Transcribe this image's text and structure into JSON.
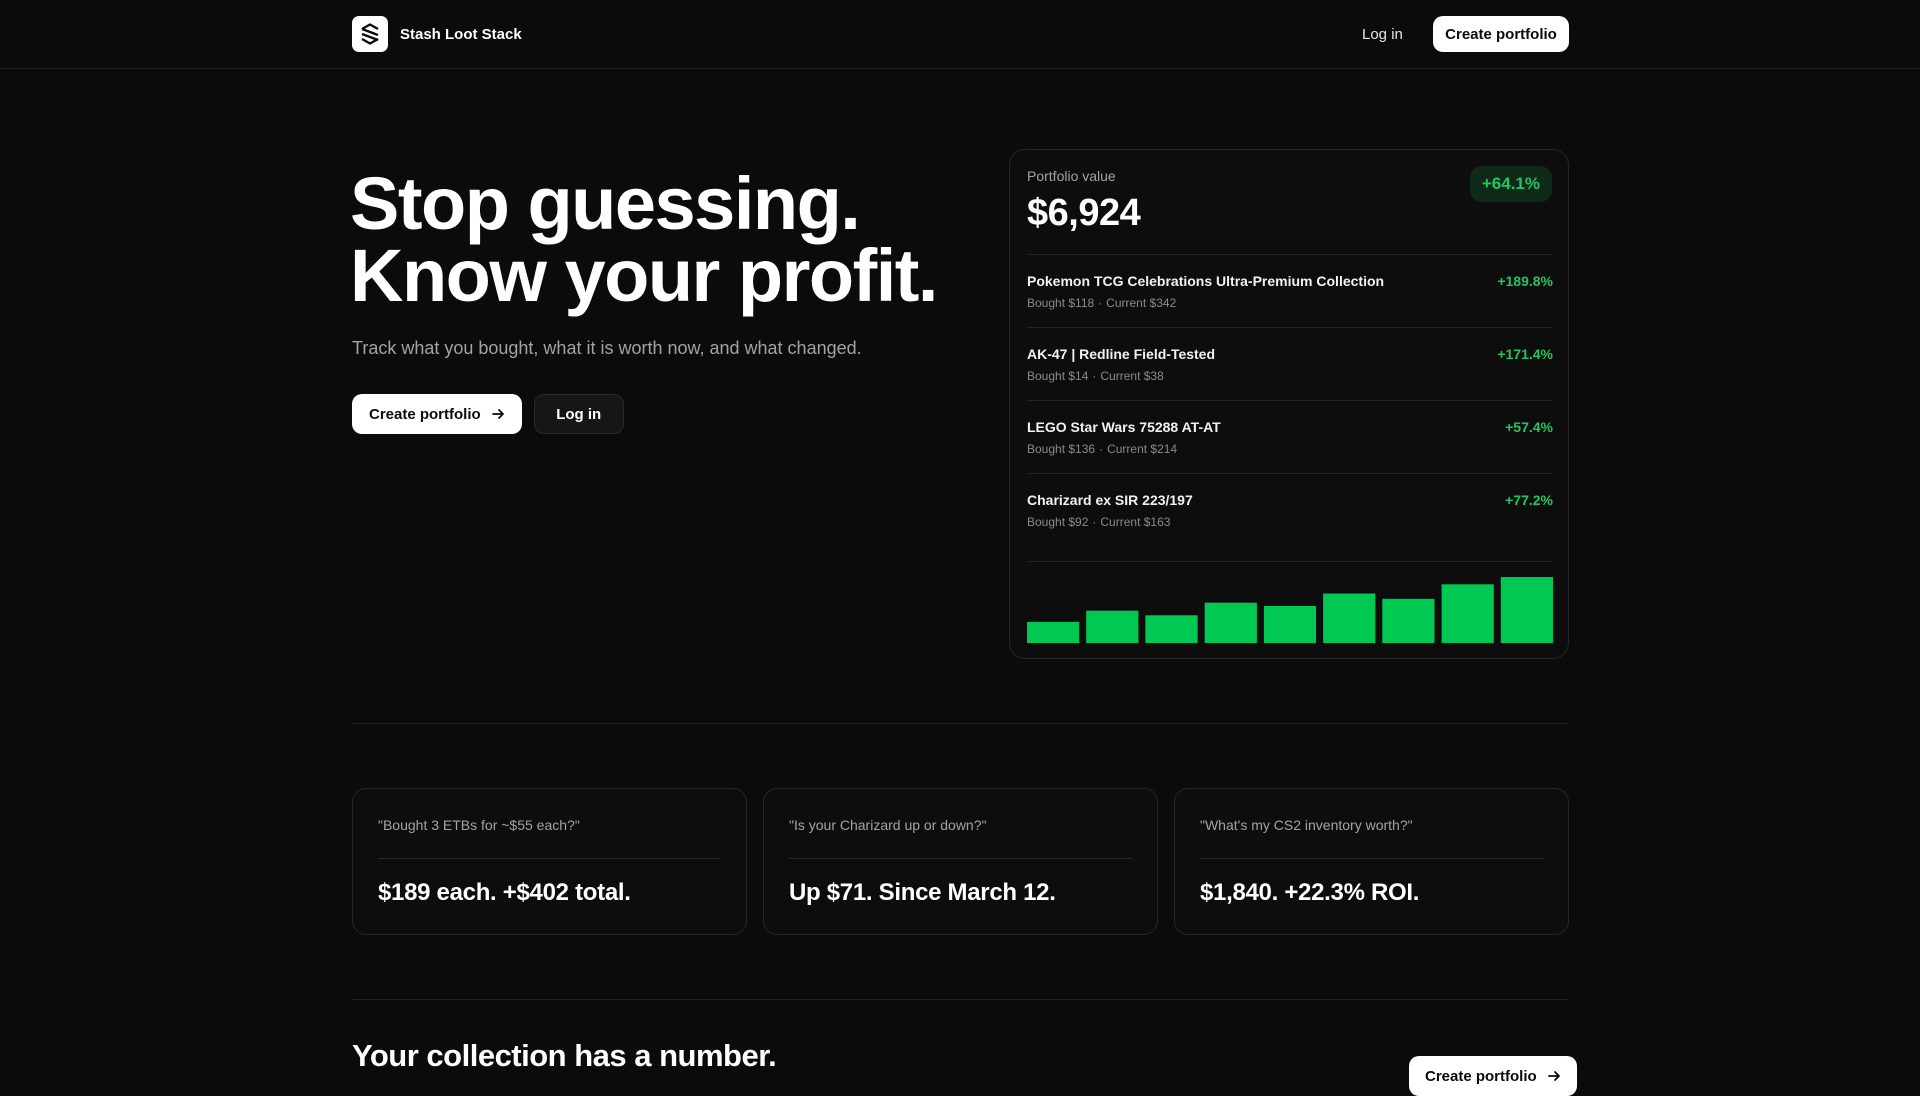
{
  "header": {
    "brand_name": "Stash Loot Stack",
    "login_label": "Log in",
    "create_label": "Create portfolio"
  },
  "hero": {
    "title_line1": "Stop guessing.",
    "title_line2": "Know your profit.",
    "subtitle": "Track what you bought, what it is worth now, and what changed.",
    "primary_cta": "Create portfolio",
    "secondary_cta": "Log in"
  },
  "portfolio": {
    "label": "Portfolio value",
    "value": "$6,924",
    "change": "+64.1%",
    "items": [
      {
        "name": "Pokemon TCG Celebrations Ultra-Premium Collection",
        "bought": "Bought $118",
        "current": "Current $342",
        "change": "+189.8%"
      },
      {
        "name": "AK-47 | Redline Field-Tested",
        "bought": "Bought $14",
        "current": "Current $38",
        "change": "+171.4%"
      },
      {
        "name": "LEGO Star Wars 75288 AT-AT",
        "bought": "Bought $136",
        "current": "Current $214",
        "change": "+57.4%"
      },
      {
        "name": "Charizard ex SIR 223/197",
        "bought": "Bought $92",
        "current": "Current $163",
        "change": "+77.2%"
      }
    ],
    "bar_levels": [
      0.32,
      0.49,
      0.42,
      0.61,
      0.56,
      0.75,
      0.67,
      0.89,
      1.0
    ],
    "accent_color": "#00c853"
  },
  "quotes": [
    {
      "question": "\"Bought 3 ETBs for ~$55 each?\"",
      "answer": "$189 each. +$402 total."
    },
    {
      "question": "\"Is your Charizard up or down?\"",
      "answer": "Up $71. Since March 12."
    },
    {
      "question": "\"What's my CS2 inventory worth?\"",
      "answer": "$1,840. +22.3% ROI."
    }
  ],
  "section": {
    "title": "Your collection has a number.",
    "cta": "Create portfolio"
  },
  "icons": {
    "logo": "stack-logo-icon",
    "arrow": "arrow-right-icon"
  }
}
